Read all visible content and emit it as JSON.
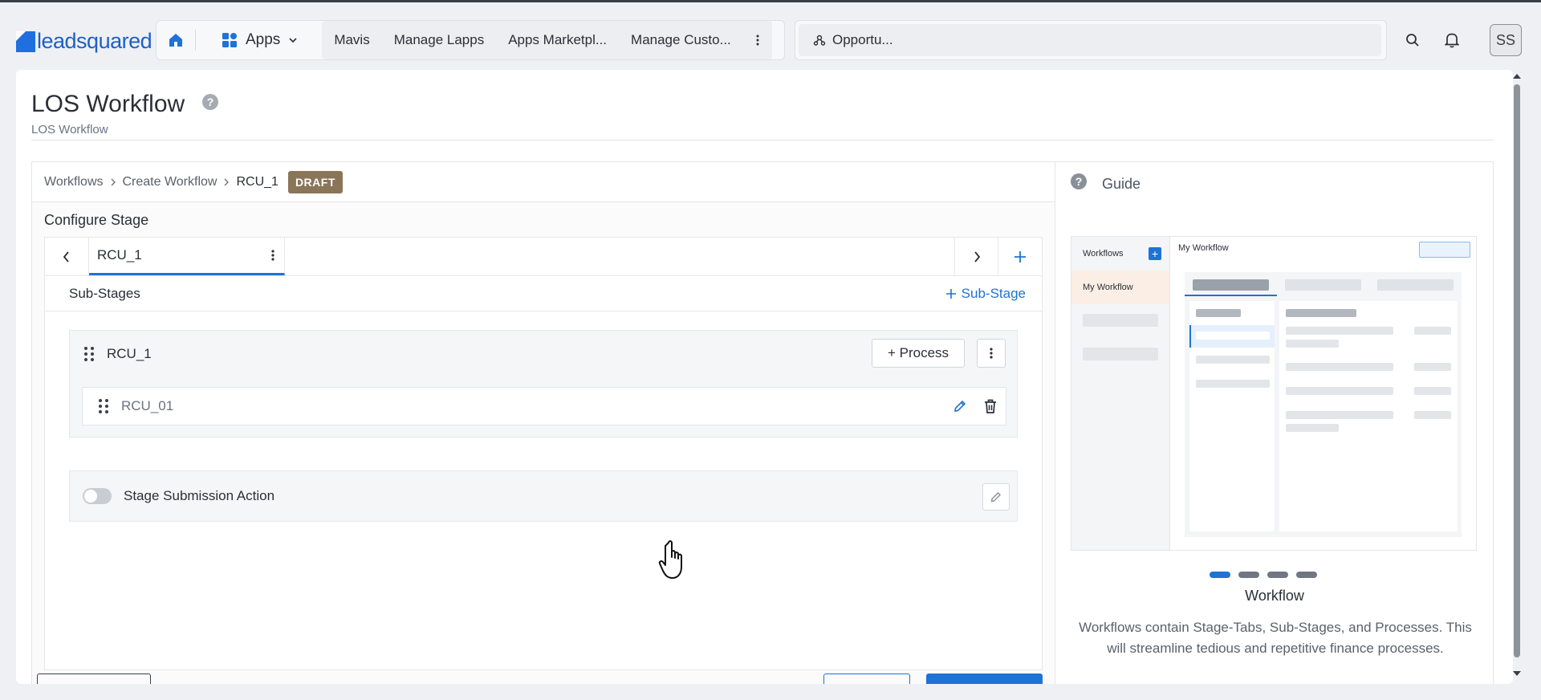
{
  "topbar": {
    "logo_text": "leadsquared",
    "apps_label": "Apps",
    "nav_links": [
      "Mavis",
      "Manage Lapps",
      "Apps Marketpl...",
      "Manage Custo..."
    ],
    "search_value": "Opportu...",
    "avatar_initials": "SS",
    "brand_color": "#1f5fc8"
  },
  "page": {
    "title": "LOS Workflow",
    "subtitle": "LOS Workflow"
  },
  "breadcrumb": {
    "items": [
      "Workflows",
      "Create Workflow"
    ],
    "current": "RCU_1",
    "badge": "DRAFT"
  },
  "configure": {
    "title": "Configure Stage",
    "tab_label": "RCU_1",
    "substages_title": "Sub-Stages",
    "add_substage_label": "Sub-Stage",
    "substage": {
      "name": "RCU_1",
      "process_button": "+ Process",
      "process_name": "RCU_01"
    },
    "stage_submission_label": "Stage Submission Action",
    "stage_submission_enabled": false
  },
  "guide": {
    "title": "Guide",
    "preview": {
      "sidebar_title": "Workflows",
      "sidebar_item": "My Workflow",
      "main_title": "My Workflow"
    },
    "slide_count": 4,
    "active_slide": 1,
    "card_title": "Workflow",
    "description": "Workflows contain Stage-Tabs, Sub-Stages, and Processes. This will streamline tedious and repetitive finance processes."
  },
  "icons": {
    "home": "home-icon",
    "apps": "apps-grid-icon",
    "search": "search-icon",
    "bell": "bell-icon",
    "help": "help-circle-icon"
  },
  "colors": {
    "accent": "#1f72d6",
    "draft_badge": "#8a7558"
  }
}
